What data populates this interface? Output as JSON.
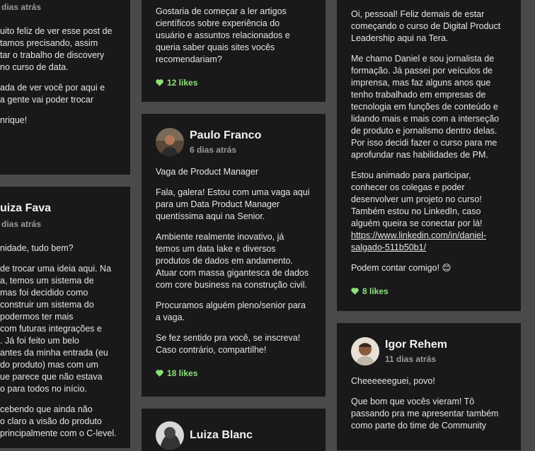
{
  "colors": {
    "background": "#4a4a4a",
    "card": "#191919",
    "likes": "#8ee07a"
  },
  "left_top": {
    "date": "dias atrás",
    "paragraphs": [
      "uito feliz de ver esse post de\ntamos precisando, assim\ntar o trabalho de discovery\n no curso de data.",
      "ada de ver você por aqui e\n a gente vai poder trocar",
      "nrique!"
    ]
  },
  "left_bottom": {
    "name": "uiza Fava",
    "date": "dias atrás",
    "paragraphs": [
      "nidade, tudo bem?",
      "de trocar uma ideia aqui. Na\na, temos um sistema de\nmas foi decidido como\n construir um sistema do\n podermos ter mais\n com futuras integrações e\n. Já foi feito um belo\n antes da minha entrada (eu\ndo produto) mas com um\nue parece que não estava\no para todos no início.",
      "cebendo que ainda não\no claro a visão do produto\nprincipalmente com o C-level."
    ]
  },
  "mid_top": {
    "paragraphs": [
      "Gostaria de começar a ler artigos\ncientíficos sobre experiência do\nusuário e assuntos relacionados e\nqueria saber quais sites vocês\nrecomendariam?"
    ],
    "likes": "12 likes"
  },
  "mid_paulo": {
    "name": "Paulo Franco",
    "date": "6 dias atrás",
    "paragraphs": [
      "Vaga de Product Manager",
      "Fala, galera! Estou com uma vaga aqui\npara um Data Product Manager\nquentíssima aqui na Senior.",
      "Ambiente realmente inovativo, já\ntemos um data lake e diversos\nprodutos de dados em andamento.\nAtuar com massa gigantesca de dados\ncom core business na construção civil.",
      "Procuramos alguém pleno/senior para\na vaga.",
      "Se fez sentido pra você, se inscreva!\nCaso contrário, compartilhe!"
    ],
    "likes": "18 likes"
  },
  "mid_luiza": {
    "name": "Luiza Blanc"
  },
  "right_daniel": {
    "paragraphs": [
      "Oi, pessoal! Feliz demais de estar\ncomeçando o curso de Digital Product\nLeadership aqui na Tera.",
      "Me chamo Daniel e sou jornalista de\nformação. Já passei por veículos de\nimprensa, mas faz alguns anos que\ntenho trabalhado em empresas de\ntecnologia em funções de conteúdo e\nlidando mais e mais com a interseção\nde produto e jornalismo dentro delas.\nPor isso decidi fazer o curso para me\naprofundar nas habilidades de PM.",
      "Estou animado para participar,\nconhecer os colegas e poder\ndesenvolver um projeto no curso!\nTambém estou no LinkedIn, caso\nalguém queira se conectar por lá!"
    ],
    "link": "https://www.linkedin.com/in/daniel-\nsalgado-511b50b1/",
    "closing": "Podem contar comigo! 😊",
    "likes": "8 likes"
  },
  "right_igor": {
    "name": "Igor Rehem",
    "date": "11 dias atrás",
    "paragraphs": [
      "Cheeeeeeguei, povo!",
      "Que bom que vocês vieram! Tô\npassando pra me apresentar também\ncomo parte do time de Community"
    ]
  }
}
